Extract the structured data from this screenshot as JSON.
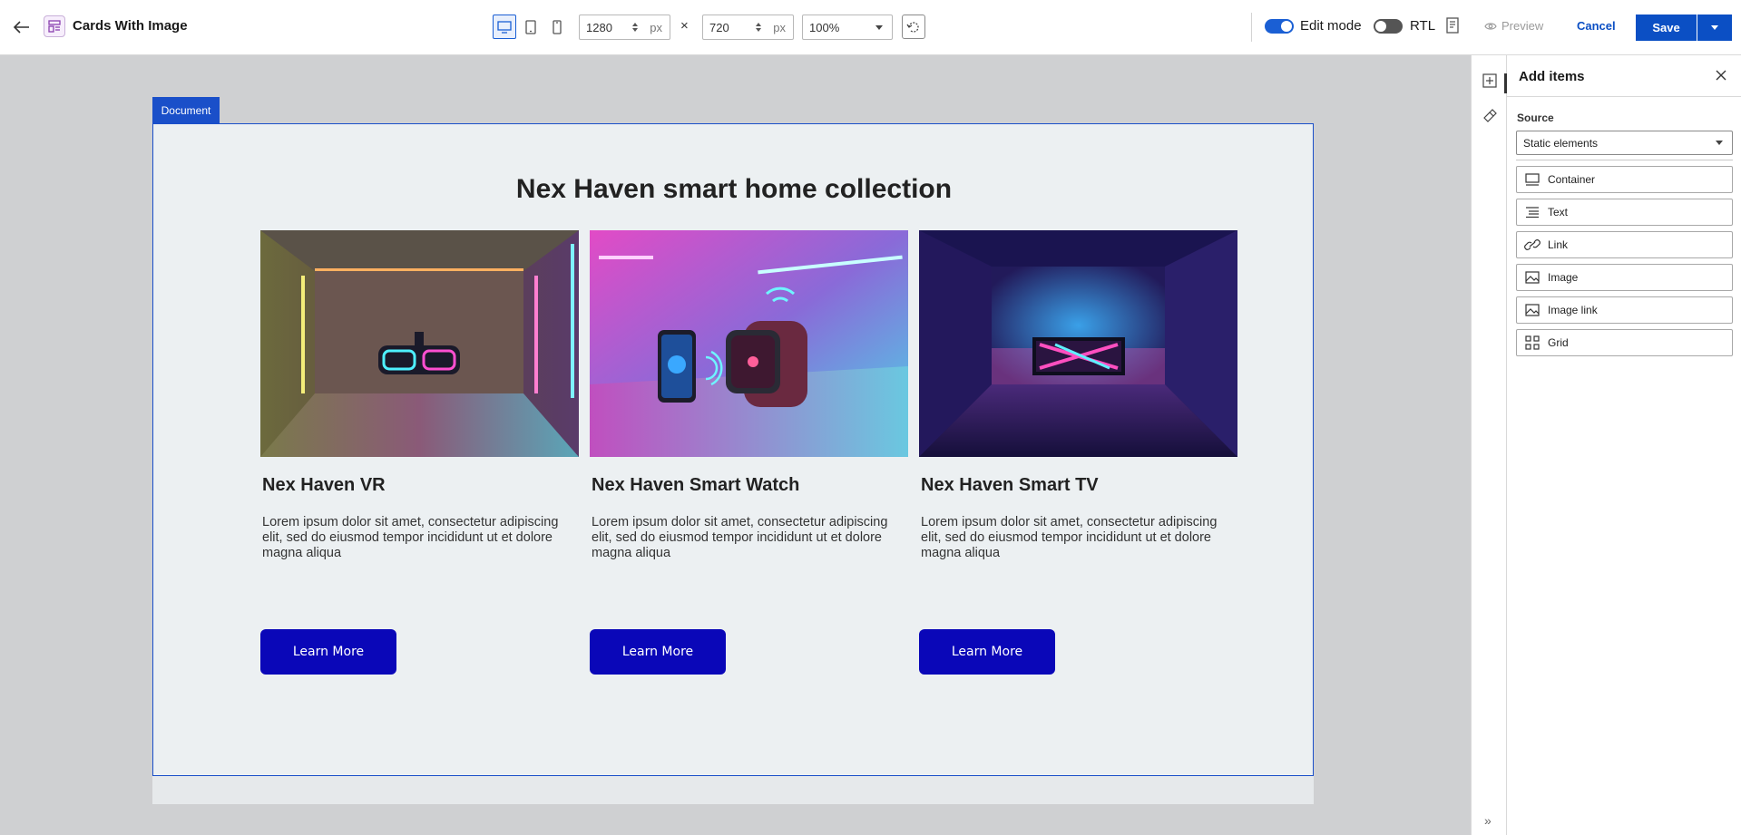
{
  "header": {
    "title": "Cards With Image",
    "width_value": "1280",
    "height_value": "720",
    "unit": "px",
    "times": "×",
    "zoom": "100%",
    "edit_mode_label": "Edit mode",
    "edit_mode_on": true,
    "rtl_label": "RTL",
    "rtl_on": false,
    "preview_label": "Preview",
    "cancel_label": "Cancel",
    "save_label": "Save"
  },
  "canvas": {
    "document_tag": "Document",
    "heading": "Nex Haven smart home collection",
    "cards": [
      {
        "title": "Nex Haven VR",
        "text": "Lorem ipsum dolor sit amet, consectetur adipiscing elit, sed do eiusmod tempor incididunt ut et dolore magna aliqua",
        "button": "Learn More",
        "image": "vr-headset-neon-room"
      },
      {
        "title": "Nex Haven Smart Watch",
        "text": "Lorem ipsum dolor sit amet, consectetur adipiscing elit, sed do eiusmod tempor incididunt ut et dolore magna aliqua",
        "button": "Learn More",
        "image": "smartwatch-phone-neon"
      },
      {
        "title": "Nex Haven Smart TV",
        "text": "Lorem ipsum dolor sit amet, consectetur adipiscing elit, sed do eiusmod tempor incididunt ut et dolore magna aliqua",
        "button": "Learn More",
        "image": "tv-neon-corridor"
      }
    ]
  },
  "panel": {
    "title": "Add items",
    "source_label": "Source",
    "source_value": "Static elements",
    "items": [
      {
        "label": "Container",
        "icon": "container-icon"
      },
      {
        "label": "Text",
        "icon": "text-icon"
      },
      {
        "label": "Link",
        "icon": "link-icon"
      },
      {
        "label": "Image",
        "icon": "image-icon"
      },
      {
        "label": "Image link",
        "icon": "image-link-icon"
      },
      {
        "label": "Grid",
        "icon": "grid-icon"
      }
    ]
  },
  "colors": {
    "accent": "#0b4fc4",
    "card_button": "#0a07b8",
    "canvas_bg": "#cfd0d2",
    "document_bg": "#ecf0f2"
  }
}
